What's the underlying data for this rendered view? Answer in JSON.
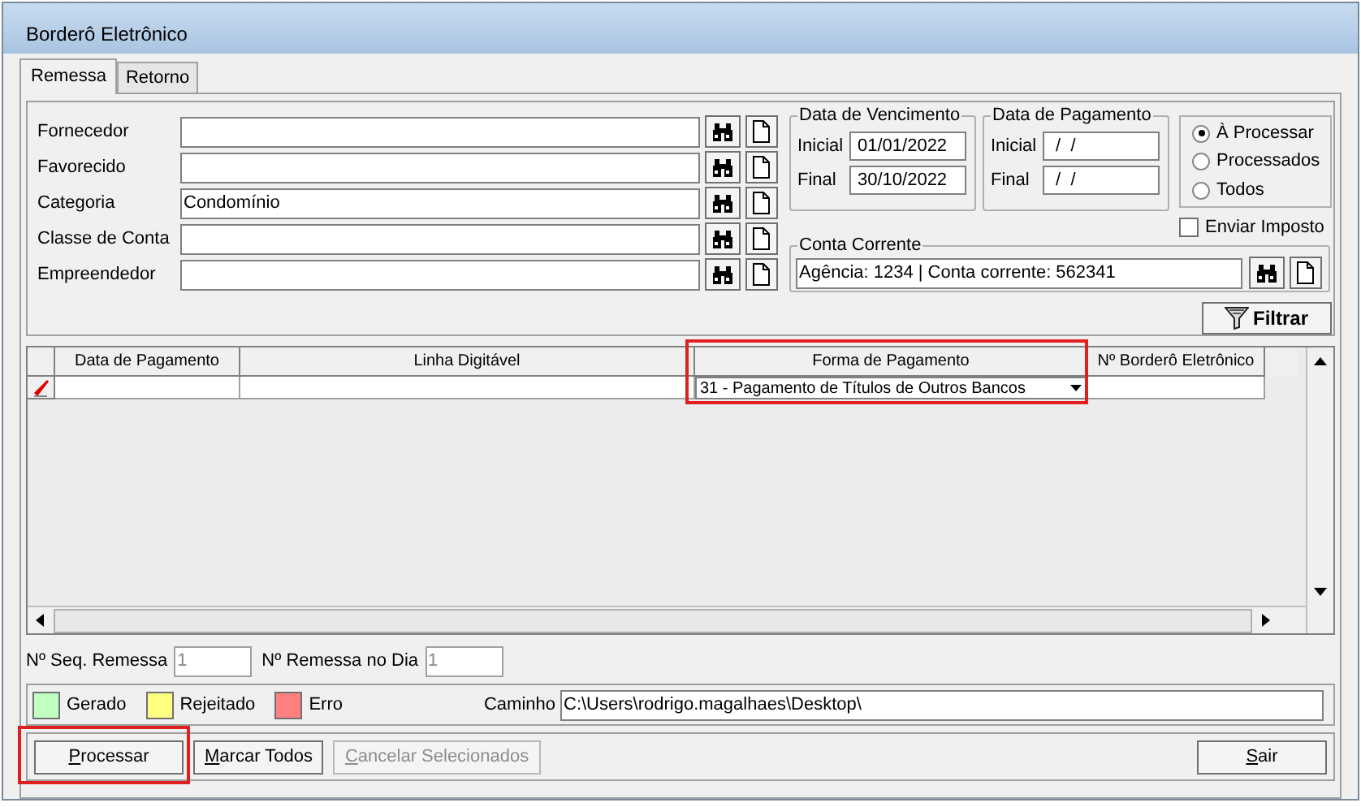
{
  "window": {
    "title": "Borderô Eletrônico"
  },
  "tabs": [
    {
      "label": "Remessa",
      "selected": true
    },
    {
      "label": "Retorno",
      "selected": false
    }
  ],
  "filters": [
    {
      "label": "Fornecedor"
    },
    {
      "label": "Favorecido"
    },
    {
      "label": "Categoria",
      "value": "Condomínio"
    },
    {
      "label": "Classe de Conta"
    },
    {
      "label": "Empreendedor"
    }
  ],
  "date_groups": [
    {
      "title": "Data de Vencimento",
      "inicial_label": "Inicial",
      "inicial": "01/01/2022",
      "final_label": "Final",
      "final": "30/10/2022"
    },
    {
      "title": "Data de Pagamento",
      "inicial_label": "Inicial",
      "inicial": " /  /",
      "final_label": "Final",
      "final": " /  /"
    }
  ],
  "status_options": [
    {
      "label": "À Processar",
      "selected": true
    },
    {
      "label": "Processados",
      "selected": false
    },
    {
      "label": "Todos",
      "selected": false
    }
  ],
  "enviar_imposto": {
    "label": "Enviar Imposto",
    "checked": false
  },
  "conta_corrente": {
    "title": "Conta Corrente",
    "value": "Agência: 1234 | Conta corrente: 562341"
  },
  "filter_button": {
    "label": "Filtrar"
  },
  "grid": {
    "columns": [
      {
        "label": "Data de Pagamento",
        "highlighted": false
      },
      {
        "label": "Linha Digitável",
        "highlighted": false
      },
      {
        "label": "Forma de Pagamento",
        "highlighted": true
      },
      {
        "label": "Nº Borderô Eletrônico",
        "highlighted": false
      }
    ],
    "rows": [
      {
        "editing": true,
        "forma_pagamento": "31 - Pagamento de Títulos de Outros Bancos"
      }
    ]
  },
  "seq": [
    {
      "label": "Nº Seq. Remessa",
      "value": "1",
      "disabled": true
    },
    {
      "label": "Nº Remessa no Dia",
      "value": "1",
      "disabled": true
    }
  ],
  "legend": [
    {
      "label": "Gerado",
      "color": "#c0ffc0"
    },
    {
      "label": "Rejeitado",
      "color": "#ffff80"
    },
    {
      "label": "Erro",
      "color": "#ff8080"
    }
  ],
  "caminho": {
    "label": "Caminho",
    "value": "C:\\Users\\rodrigo.magalhaes\\Desktop\\"
  },
  "buttons": [
    {
      "label": "Processar",
      "disabled": false,
      "highlighted": true
    },
    {
      "label": "Marcar Todos",
      "disabled": false,
      "highlighted": false
    },
    {
      "label": "Cancelar Selecionados",
      "disabled": true,
      "highlighted": false
    },
    {
      "label": "Sair",
      "disabled": false,
      "highlighted": false
    }
  ]
}
